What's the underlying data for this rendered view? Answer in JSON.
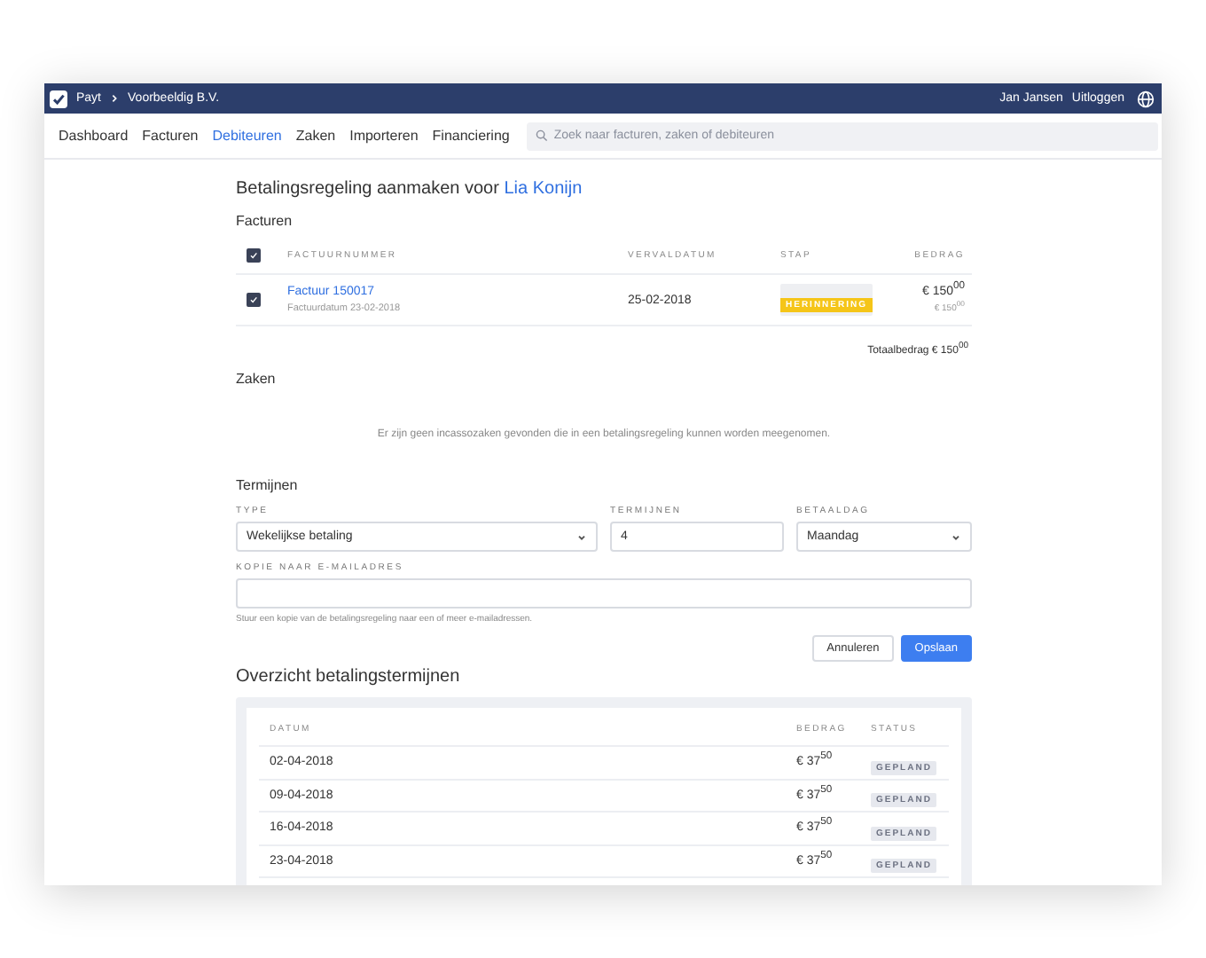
{
  "topbar": {
    "app": "Payt",
    "breadcrumb": "Voorbeeldig B.V.",
    "user": "Jan Jansen",
    "logout": "Uitloggen"
  },
  "nav": {
    "items": [
      {
        "label": "Dashboard",
        "selected": false
      },
      {
        "label": "Facturen",
        "selected": false
      },
      {
        "label": "Debiteuren",
        "selected": true
      },
      {
        "label": "Zaken",
        "selected": false
      },
      {
        "label": "Importeren",
        "selected": false
      },
      {
        "label": "Financiering",
        "selected": false
      }
    ],
    "search": {
      "placeholder": "Zoek naar facturen, zaken of debiteuren"
    }
  },
  "title": {
    "text": "Betalingsregeling aanmaken voor",
    "link": "Lia Konijn"
  },
  "invoices": {
    "heading": "Facturen",
    "select_all": {
      "checked": true
    },
    "columns": [
      "FACTUURNUMMER",
      "VERVALDATUM",
      "STAP",
      "BEDRAG"
    ],
    "rows": [
      {
        "checked": true,
        "number": "Factuur 150017",
        "subtitle": "Factuurdatum 23-02-2018",
        "due": "25-02-2018",
        "step": "HERINNERING",
        "amount": "€ 150$^{00}$",
        "amount_sub": "€ 150$^{00}$"
      }
    ],
    "total": "Totaalbedrag € 150$^{00}$"
  },
  "cases": {
    "heading": "Zaken",
    "empty": "Er zijn geen incassozaken gevonden die in een betalingsregeling kunnen worden meegenomen."
  },
  "terms": {
    "heading": "Termijnen",
    "fields": [
      {
        "kind": "select",
        "label": "TYPE",
        "value": "Wekelijkse betaling"
      },
      {
        "kind": "input",
        "label": "TERMIJNEN",
        "value": "4"
      },
      {
        "kind": "select",
        "label": "BETAALDAG",
        "value": "Maandag"
      }
    ],
    "email": {
      "label": "KOPIE NAAR E-MAILADRES",
      "hint": "Stuur een kopie van de betalingsregeling naar een of meer e-mailadressen."
    },
    "buttons": [
      {
        "label": "Annuleren",
        "kind": "secondary"
      },
      {
        "label": "Opslaan",
        "kind": "primary"
      }
    ]
  },
  "overview": {
    "heading": "Overzicht betalingstermijnen",
    "columns": [
      "DATUM",
      "BEDRAG",
      "STATUS"
    ],
    "rows": [
      {
        "date": "02-04-2018",
        "amount": "€ 37$^{50}$",
        "status": "GEPLAND"
      },
      {
        "date": "09-04-2018",
        "amount": "€ 37$^{50}$",
        "status": "GEPLAND"
      },
      {
        "date": "16-04-2018",
        "amount": "€ 37$^{50}$",
        "status": "GEPLAND"
      },
      {
        "date": "23-04-2018",
        "amount": "€ 37$^{50}$",
        "status": "GEPLAND"
      }
    ]
  }
}
